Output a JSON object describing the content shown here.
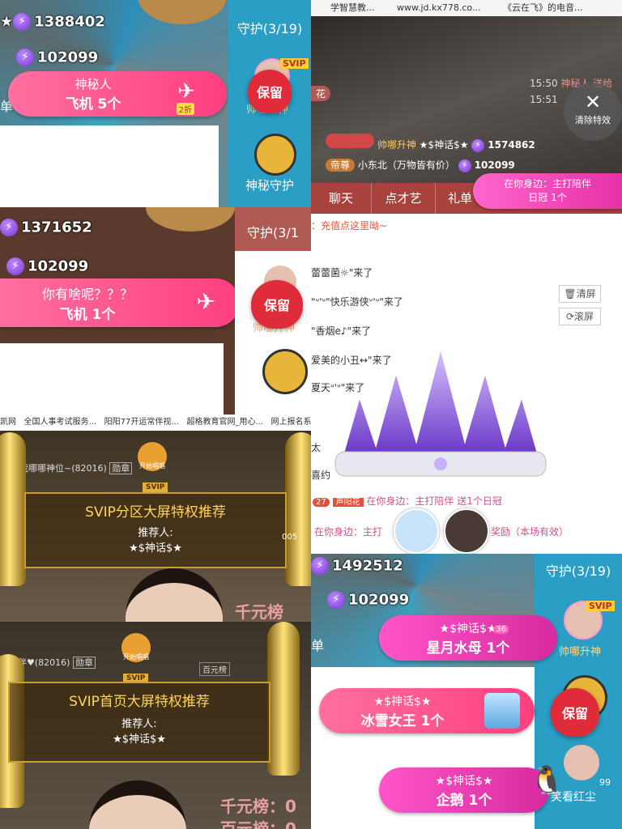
{
  "panel1": {
    "count_top": "1388402",
    "count_bottom": "102099",
    "gift_user": "神秘人",
    "gift_item": "飞机 5个",
    "discount": "2折",
    "guard_title": "守护(3/19)",
    "svip": "SVIP",
    "keep": "保留",
    "rank_name": "帅哪升神",
    "guard_mystery": "神秘守护",
    "left_tab": "单"
  },
  "panel2": {
    "count_top": "1371652",
    "count_bottom": "102099",
    "gift_user": "你有啥呢？？？",
    "gift_item": "飞机 1个",
    "guard_title": "守护(3/1",
    "keep": "保留",
    "rank_name": "帅哪升神"
  },
  "panel3": {
    "browser_tabs": [
      "凯网",
      "全国人事考试服务...",
      "阳阳77开运常伴视...",
      "超格教育官网_用心...",
      "网上报名系统"
    ],
    "username_line": "我哪哪神位~(82016)",
    "tag": "勋章",
    "watermark_btn": "开始唱唱",
    "svip_badge": "SVIP",
    "banner_title": "SVIP分区大屏特权推荐",
    "recommender_label": "推荐人:",
    "recommender_name": "★$神话$★",
    "rank_text": "千元榜",
    "side_num": "005"
  },
  "panel4": {
    "username_line": "运常伴♥(82016)",
    "tag": "勋章",
    "watermark_btn": "开始唱唱",
    "svip_badge": "SVIP",
    "banner_title": "SVIP首页大屏特权推荐",
    "recommender_label": "推荐人:",
    "recommender_name": "★$神话$★",
    "rank_text": "千元榜：0",
    "right_label": "百元榜",
    "bottom_text": "百元榜：0"
  },
  "panel5": {
    "url": "www.jd.kx778.co...",
    "browser_tab": "《云在飞》的电音...",
    "browser_tab_left": "学智慧教...",
    "time1": "15:50",
    "time1_text": "神秘人 送给",
    "time2": "15:51",
    "clear_effects": "清除特效",
    "flower_tag": "花",
    "rank_name": "帅哪升神",
    "user1_tag": "★$神话$★",
    "user1_count": "1574862",
    "user2_badge": "帝尊",
    "user2_name": "小东北（万物皆有价）",
    "user2_count": "102099",
    "tabs": [
      "聊天",
      "点才艺",
      "礼单"
    ],
    "companion_title": "在你身边：主打陪伴",
    "companion_sub": "日冠 1个",
    "recharge": "：充值点这里呦~",
    "chat": [
      "蕾蕾菌☼\"来了",
      "\"ᐡ'ᐡ\"快乐游侠ᐡ'ᐡ\"来了",
      "\"香烟e♪\"来了",
      "爱美的小丑↔\"来了",
      "夏天ᐡ'ᐡ\"来了",
      "太",
      "喜约"
    ],
    "clear_screen": "清屏",
    "scroll_screen": "滚屏",
    "gift_line_badge": "27",
    "gift_line_user": "声阳花",
    "gift_line_text": "在你身边：主打陪伴 送1个日冠",
    "bottom_line": "在你身边：主打",
    "bottom_line_tail": "奖励（本场有效）"
  },
  "panel6": {
    "count_top": "1492512",
    "count_bottom": "102099",
    "guard_title": "守护(3/19)",
    "svip": "SVIP",
    "keep": "保留",
    "rank_name": "帅哪升神",
    "left_tab": "单",
    "gift1_user": "★$神话$★",
    "gift1_item": "星月水母 1个",
    "gift1_badge": "36",
    "gift2_user": "★$神话$★",
    "gift2_item": "冰雪女王 1个",
    "gift3_user": "★$神话$★",
    "gift3_item": "企鹅 1个",
    "side_text": "笑看红尘",
    "side_num": "99"
  }
}
